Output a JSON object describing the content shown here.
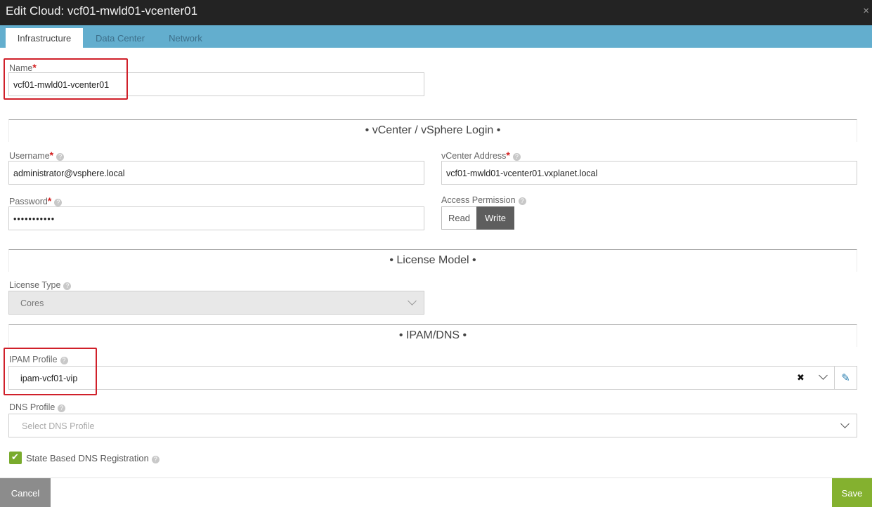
{
  "window": {
    "title": "Edit Cloud: vcf01-mwld01-vcenter01",
    "close_glyph": "×"
  },
  "tabs": [
    {
      "label": "Infrastructure",
      "active": true
    },
    {
      "label": "Data Center",
      "active": false
    },
    {
      "label": "Network",
      "active": false
    }
  ],
  "name_field": {
    "label": "Name",
    "required_mark": "*",
    "value": "vcf01-mwld01-vcenter01"
  },
  "sections": {
    "vcenter_login": "• vCenter / vSphere Login •",
    "license_model": "• License Model •",
    "ipam_dns": "• IPAM/DNS •"
  },
  "username": {
    "label": "Username",
    "value": "administrator@vsphere.local"
  },
  "vcenter_address": {
    "label": "vCenter Address",
    "value": "vcf01-mwld01-vcenter01.vxplanet.local"
  },
  "password": {
    "label": "Password",
    "value": "•••••••••••"
  },
  "access_permission": {
    "label": "Access Permission",
    "options": [
      "Read",
      "Write"
    ],
    "selected": "Write"
  },
  "license_type": {
    "label": "License Type",
    "value": "Cores"
  },
  "ipam_profile": {
    "label": "IPAM Profile",
    "value": "ipam-vcf01-vip",
    "clear_glyph": "✖",
    "edit_glyph": "✎"
  },
  "dns_profile": {
    "label": "DNS Profile",
    "placeholder": "Select DNS Profile"
  },
  "state_dns": {
    "label": "State Based DNS Registration",
    "checked": true,
    "check_glyph": "✔"
  },
  "footer": {
    "cancel_label": "Cancel",
    "save_label": "Save"
  },
  "help_glyph": "?",
  "colors": {
    "titlebar": "#232323",
    "tabbar": "#63aece",
    "save": "#84b12f",
    "cancel": "#8c8c8c",
    "required": "#d32020",
    "highlight": "#d0202a"
  },
  "icons": [
    "close-icon",
    "help-icon",
    "chevron-down-icon",
    "clear-icon",
    "pencil-icon",
    "checkmark-icon"
  ]
}
